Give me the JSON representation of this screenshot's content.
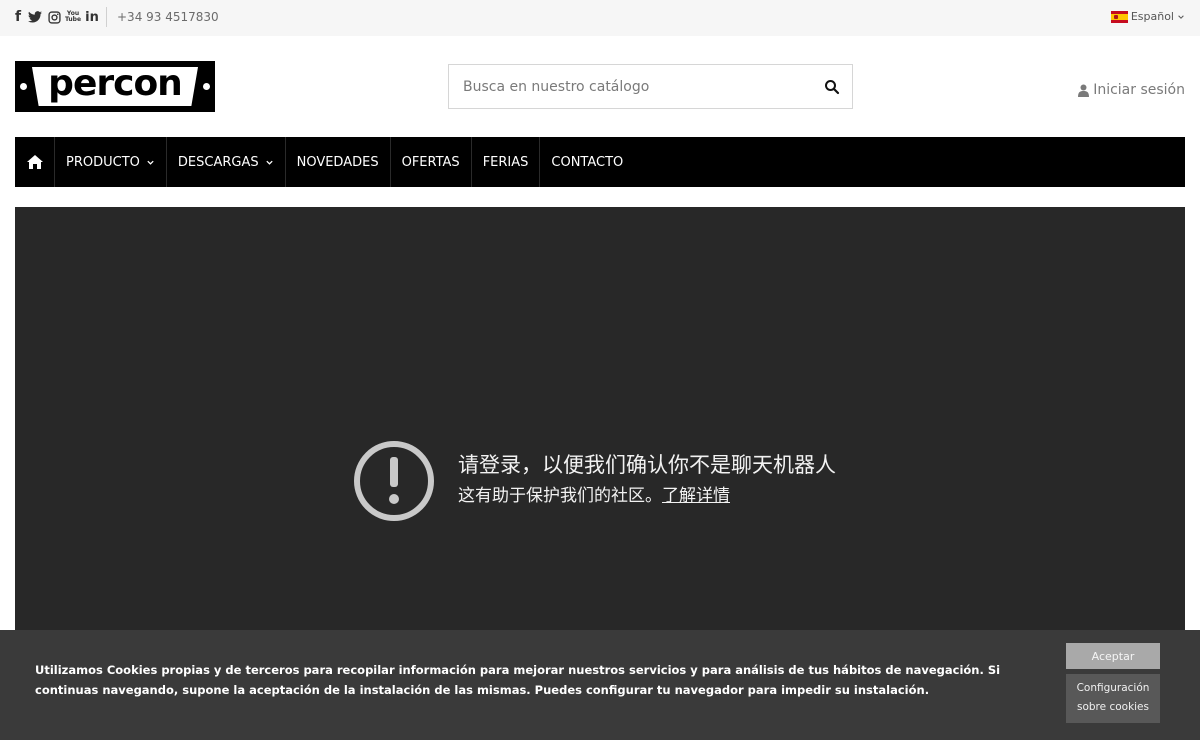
{
  "topbar": {
    "social_icons": [
      "facebook-icon",
      "twitter-icon",
      "instagram-icon",
      "youtube-icon",
      "linkedin-icon"
    ],
    "facebook_glyph": "f",
    "linkedin_glyph": "in",
    "youtube_glyph_top": "You",
    "youtube_glyph_bottom": "Tube",
    "phone": "+34 93 4517830",
    "language": "Español"
  },
  "header": {
    "logo_text": "percon",
    "search_placeholder": "Busca en nuestro catálogo",
    "login_label": "Iniciar sesión"
  },
  "nav": {
    "items": [
      {
        "label": "PRODUCTO",
        "has_dropdown": true
      },
      {
        "label": "DESCARGAS",
        "has_dropdown": true
      },
      {
        "label": "NOVEDADES",
        "has_dropdown": false
      },
      {
        "label": "OFERTAS",
        "has_dropdown": false
      },
      {
        "label": "FERIAS",
        "has_dropdown": false
      },
      {
        "label": "CONTACTO",
        "has_dropdown": false
      }
    ]
  },
  "main": {
    "heading": "请登录，以便我们确认你不是聊天机器人",
    "subtext": "这有助于保护我们的社区。",
    "link": "了解详情"
  },
  "cookie_banner": {
    "text": "Utilizamos Cookies propias y de terceros para recopilar información para mejorar nuestros servicios y para análisis de tus hábitos de navegación. Si continuas navegando, supone la aceptación de la instalación de las mismas. Puedes configurar tu navegador para impedir su instalación.",
    "accept_label": "Aceptar",
    "config_label_line1": "Configuración",
    "config_label_line2": "sobre cookies"
  },
  "colors": {
    "nav_bg": "#000000",
    "panel_bg": "#282828",
    "cookie_bg": "#3a3a3a",
    "topbar_bg": "#f6f6f6"
  }
}
